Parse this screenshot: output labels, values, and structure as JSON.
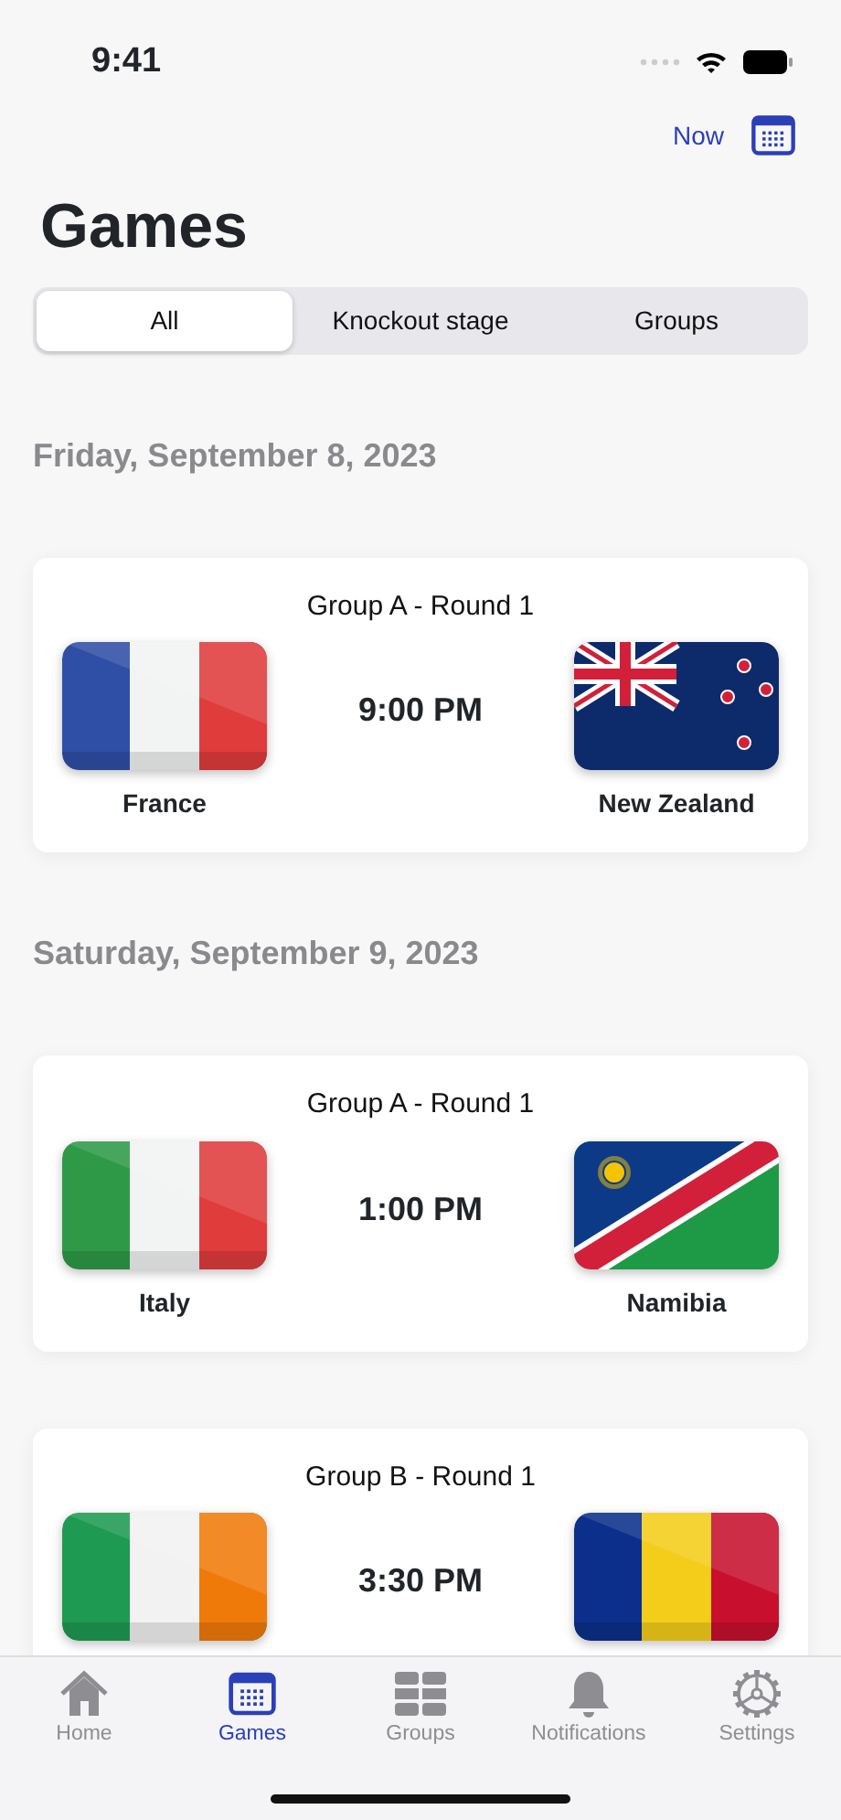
{
  "status_bar": {
    "time": "9:41"
  },
  "header": {
    "now_label": "Now",
    "title": "Games"
  },
  "segments": [
    {
      "label": "All",
      "selected": true
    },
    {
      "label": "Knockout stage",
      "selected": false
    },
    {
      "label": "Groups",
      "selected": false
    }
  ],
  "days": [
    {
      "date": "Friday, September 8, 2023",
      "games": [
        {
          "round": "Group A - Round 1",
          "time": "9:00 PM",
          "home": {
            "name": "France"
          },
          "away": {
            "name": "New Zealand"
          }
        }
      ]
    },
    {
      "date": "Saturday, September 9, 2023",
      "games": [
        {
          "round": "Group A - Round 1",
          "time": "1:00 PM",
          "home": {
            "name": "Italy"
          },
          "away": {
            "name": "Namibia"
          }
        },
        {
          "round": "Group B - Round 1",
          "time": "3:30 PM"
        }
      ]
    }
  ],
  "tab_bar": [
    {
      "label": "Home",
      "selected": false
    },
    {
      "label": "Games",
      "selected": true
    },
    {
      "label": "Groups",
      "selected": false
    },
    {
      "label": "Notifications",
      "selected": false
    },
    {
      "label": "Settings",
      "selected": false
    }
  ]
}
